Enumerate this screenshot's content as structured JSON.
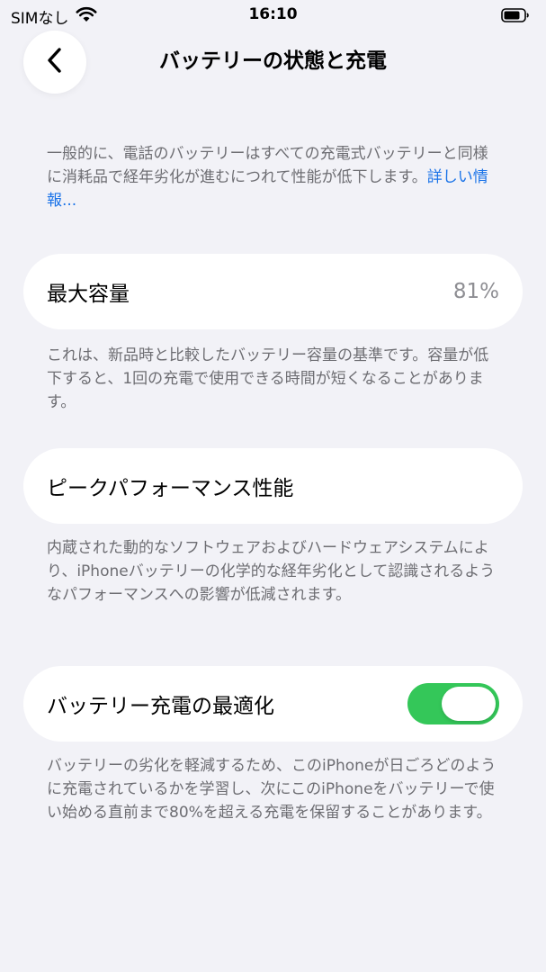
{
  "status_bar": {
    "carrier": "SIMなし",
    "time": "16:10",
    "wifi_icon": "wifi-icon",
    "battery_icon": "battery-icon"
  },
  "nav": {
    "back_icon": "chevron-left-icon",
    "title": "バッテリーの状態と充電"
  },
  "intro": {
    "text": "一般的に、電話のバッテリーはすべての充電式バッテリーと同様に消耗品で経年劣化が進むにつれて性能が低下します。",
    "link": "詳しい情報..."
  },
  "max_capacity": {
    "label": "最大容量",
    "value": "81%",
    "description": "これは、新品時と比較したバッテリー容量の基準です。容量が低下すると、1回の充電で使用できる時間が短くなることがあります。"
  },
  "peak_performance": {
    "label": "ピークパフォーマンス性能",
    "description": "内蔵された動的なソフトウェアおよびハードウェアシステムにより、iPhoneバッテリーの化学的な経年劣化として認識されるようなパフォーマンスへの影響が低減されます。"
  },
  "optimized_charging": {
    "label": "バッテリー充電の最適化",
    "enabled": true,
    "description": "バッテリーの劣化を軽減するため、このiPhoneが日ごろどのように充電されているかを学習し、次にこのiPhoneをバッテリーで使い始める直前まで80%を超える充電を保留することがあります。"
  },
  "colors": {
    "background": "#f2f2f7",
    "toggle_on": "#34c759",
    "link": "#1a73e8",
    "secondary_text": "#6d6d72"
  }
}
